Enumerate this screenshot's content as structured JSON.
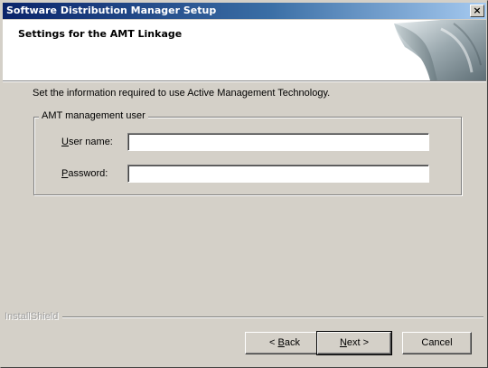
{
  "window": {
    "title": "Software Distribution Manager Setup",
    "close_glyph": "×"
  },
  "header": {
    "title": "Settings for the AMT Linkage"
  },
  "instruction": "Set the information required to use Active Management Technology.",
  "group": {
    "label": "AMT management user",
    "username": {
      "label_accel": "U",
      "label_rest": "ser name:",
      "value": ""
    },
    "password": {
      "label_accel": "P",
      "label_rest": "assword:",
      "value": ""
    }
  },
  "branding": "InstallShield",
  "buttons": {
    "back": {
      "prefix": "< ",
      "accel": "B",
      "rest": "ack"
    },
    "next": {
      "accel": "N",
      "rest": "ext >"
    },
    "cancel": "Cancel"
  },
  "colors": {
    "title_gradient_start": "#0a246a",
    "title_gradient_end": "#a6caf0",
    "face": "#d4d0c8"
  }
}
